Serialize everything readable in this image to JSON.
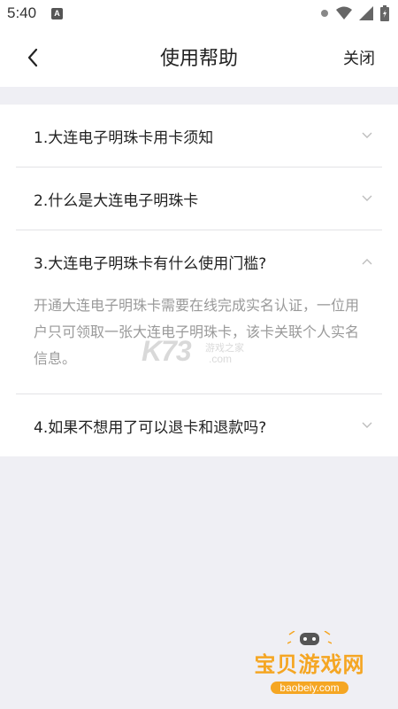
{
  "status_bar": {
    "time": "5:40",
    "app_icon_letter": "A",
    "icons": [
      "settings-dot-icon",
      "wifi-icon",
      "signal-icon",
      "battery-icon"
    ]
  },
  "nav": {
    "title": "使用帮助",
    "close_label": "关闭",
    "back_icon": "chevron-left-icon"
  },
  "faq": {
    "items": [
      {
        "question": "1.大连电子明珠卡用卡须知",
        "expanded": false
      },
      {
        "question": "2.什么是大连电子明珠卡",
        "expanded": false
      },
      {
        "question": "3.大连电子明珠卡有什么使用门槛?",
        "expanded": true,
        "answer": "开通大连电子明珠卡需要在线完成实名认证，一位用户只可领取一张大连电子明珠卡，该卡关联个人实名信息。"
      },
      {
        "question": "4.如果不想用了可以退卡和退款吗?",
        "expanded": false
      }
    ]
  },
  "watermarks": {
    "k73": "K73",
    "k73_sub": "游戏之家",
    "k73_domain": ".com",
    "baobei_title": "宝贝游戏网",
    "baobei_domain": "baobeiy.com"
  },
  "colors": {
    "background": "#efeff4",
    "answer_text": "#9a9a9a",
    "divider": "#e3e3e6"
  }
}
